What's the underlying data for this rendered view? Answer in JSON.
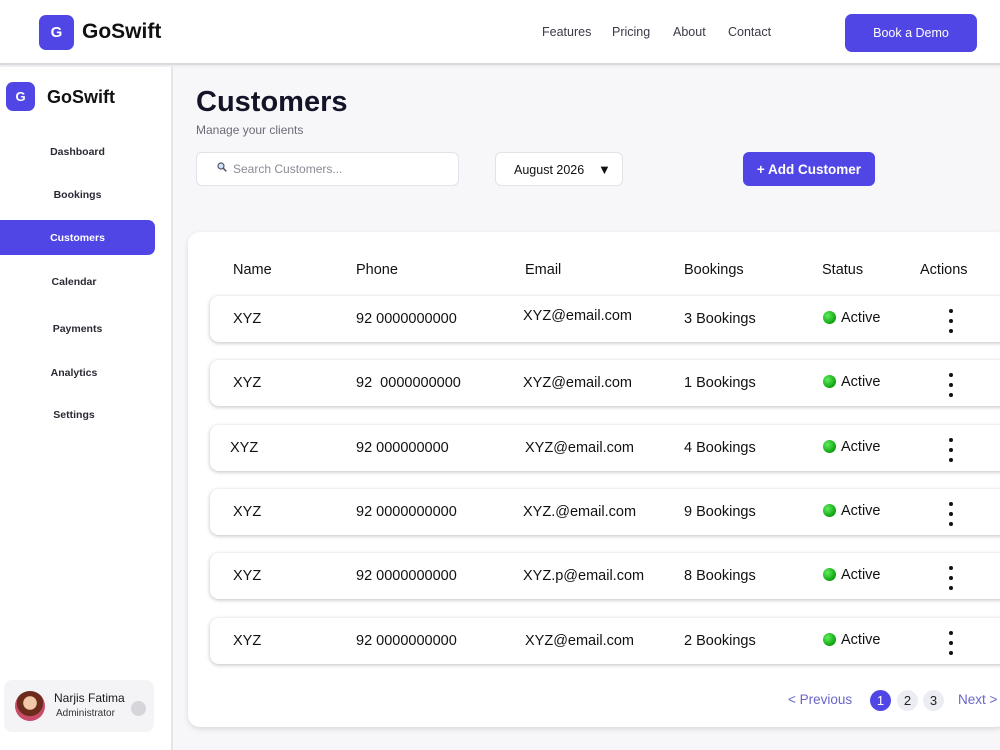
{
  "topnav": {
    "logo_letter": "G",
    "brand": "GoSwift",
    "links": [
      "Features",
      "Pricing",
      "About",
      "Contact"
    ],
    "cta": "Book a Demo"
  },
  "sidebar": {
    "logo_letter": "G",
    "brand": "GoSwift",
    "items": [
      "Dashboard",
      "Bookings",
      "Customers",
      "Calendar",
      "Payments",
      "Analytics",
      "Settings"
    ],
    "active_item": "Customers",
    "user": {
      "name": "Narjis Fatima",
      "role": "Administrator"
    }
  },
  "page": {
    "title": "Customers",
    "subtitle": "Manage your clients",
    "search_placeholder": "Search Customers...",
    "month_value": "August 2026",
    "month_caret": "▼",
    "add_button": "+ Add Customer"
  },
  "table": {
    "headers": [
      "Name",
      "Phone",
      "Email",
      "Bookings",
      "Status",
      "Actions"
    ],
    "rows": [
      {
        "name": "XYZ",
        "phone": "92 0000000000",
        "email": "XYZ@email.com",
        "bookings": "3 Bookings",
        "status": "Active"
      },
      {
        "name": "XYZ",
        "phone": "92  0000000000",
        "email": "XYZ@email.com",
        "bookings": "1 Bookings",
        "status": "Active"
      },
      {
        "name": "XYZ",
        "phone": "92 000000000",
        "email": "XYZ@email.com",
        "bookings": "4 Bookings",
        "status": "Active"
      },
      {
        "name": "XYZ",
        "phone": "92 0000000000",
        "email": "XYZ.@email.com",
        "bookings": "9 Bookings",
        "status": "Active"
      },
      {
        "name": "XYZ",
        "phone": "92 0000000000",
        "email": "XYZ.p@email.com",
        "bookings": "8 Bookings",
        "status": "Active"
      },
      {
        "name": "XYZ",
        "phone": "92 0000000000",
        "email": "XYZ@email.com",
        "bookings": "2 Bookings",
        "status": "Active"
      }
    ]
  },
  "pagination": {
    "previous": "< Previous",
    "pages": [
      "1",
      "2",
      "3"
    ],
    "current": "1",
    "next": "Next >"
  },
  "colors": {
    "accent": "#5046e5",
    "status_active": "#22c022"
  },
  "icons": [
    "search-icon",
    "status-active-icon",
    "kebab-menu-icon",
    "avatar"
  ]
}
